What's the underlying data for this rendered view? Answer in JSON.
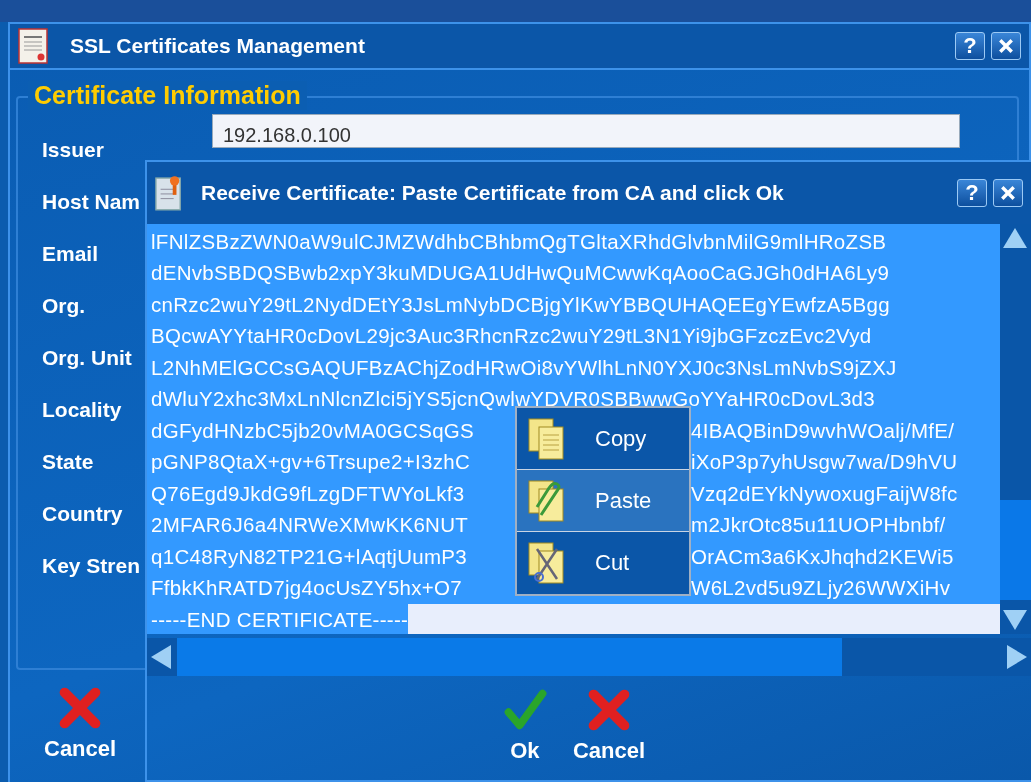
{
  "main_window": {
    "title": "SSL Certificates Management",
    "help_label": "?",
    "group_title": "Certificate Information",
    "fields": [
      {
        "label": "Issuer",
        "value": "192.168.0.100"
      },
      {
        "label": "Host Nam"
      },
      {
        "label": "Email"
      },
      {
        "label": "Org."
      },
      {
        "label": "Org. Unit"
      },
      {
        "label": "Locality"
      },
      {
        "label": "State"
      },
      {
        "label": "Country"
      },
      {
        "label": "Key Stren"
      }
    ],
    "buttons": [
      {
        "label": "Cancel",
        "kind": "cancel"
      }
    ]
  },
  "dialog": {
    "title": "Receive Certificate: Paste Certificate from CA and click Ok",
    "help_label": "?",
    "text_lines": [
      {
        "kind": "full",
        "text": "lFNlZSBzZWN0aW9ulCJMZWdhbCBhbmQgTGltaXRhdGlvbnMilG9mlHRoZSB"
      },
      {
        "kind": "full",
        "text": "dENvbSBDQSBwb2xpY3kuMDUGA1UdHwQuMCwwKqAooCaGJGh0dHA6Ly9"
      },
      {
        "kind": "full",
        "text": "cnRzc2wuY29tL2NydDEtY3JsLmNybDCBjgYlKwYBBQUHAQEEgYEwfzA5Bgg"
      },
      {
        "kind": "full",
        "text": "BQcwAYYtaHR0cDovL29jc3Auc3RhcnRzc2wuY29tL3N1Yi9jbGFzczEvc2Vyd"
      },
      {
        "kind": "full",
        "text": "L2NhMElGCCsGAQUFBzAChjZodHRwOi8vYWlhLnN0YXJ0c3NsLmNvbS9jZXJ"
      },
      {
        "kind": "full",
        "text": "dWluY2xhc3MxLnNlcnZlci5jYS5jcnQwlwYDVR0SBBwwGoYYaHR0cDovL3d3"
      },
      {
        "kind": "split",
        "left": "dGFydHNzbC5jb20vMA0GCSqGS",
        "right": "4IBAQBinD9wvhWOalj/MfE/"
      },
      {
        "kind": "split",
        "left": "pGNP8QtaX+gv+6Trsupe2+I3zhC",
        "right": "iXoP3p7yhUsgw7wa/D9hVU"
      },
      {
        "kind": "split",
        "left": "Q76Egd9JkdG9fLzgDFTWYoLkf3",
        "right": "Vzq2dEYkNywoxugFaijW8fc"
      },
      {
        "kind": "split",
        "left": "2MFAR6J6a4NRWeXMwKK6NUT",
        "right": "m2JkrOtc85u11UOPHbnbf/"
      },
      {
        "kind": "split",
        "left": "q1C48RyN82TP21G+lAqtjUumP3",
        "right": "OrACm3a6KxJhqhd2KEWi5"
      },
      {
        "kind": "split",
        "left": "FfbkKhRATD7jg4ocUsZY5hx+O7",
        "right": "W6L2vd5u9ZLjy26WWXiHv"
      },
      {
        "kind": "end",
        "text": "-----END CERTIFICATE-----"
      }
    ],
    "buttons": [
      {
        "label": "Ok",
        "kind": "ok"
      },
      {
        "label": "Cancel",
        "kind": "cancel"
      }
    ]
  },
  "context_menu": {
    "items": [
      {
        "label": "Copy",
        "kind": "copy",
        "selected": false
      },
      {
        "label": "Paste",
        "kind": "paste",
        "selected": true
      },
      {
        "label": "Cut",
        "kind": "cut",
        "selected": false
      }
    ]
  }
}
